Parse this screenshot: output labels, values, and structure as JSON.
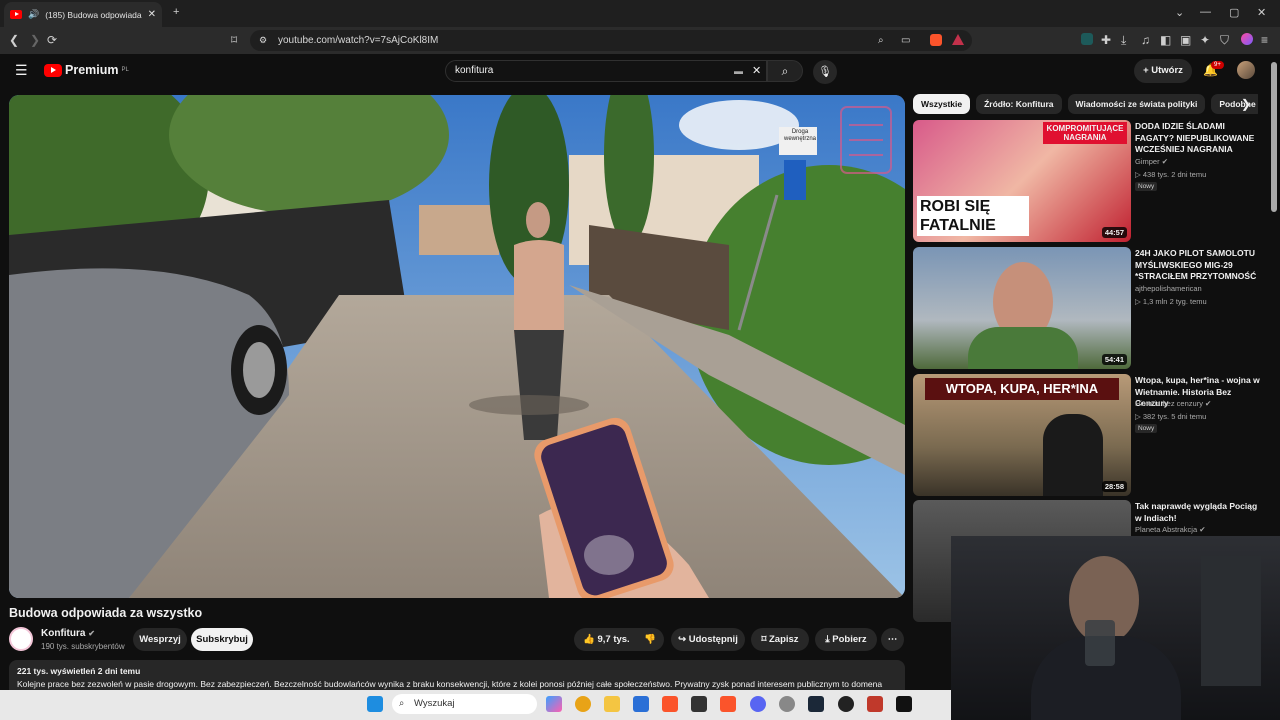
{
  "browser": {
    "tab_title": "(185) Budowa odpowiada za",
    "url": "youtube.com/watch?v=7sAjCoKl8IM"
  },
  "youtube": {
    "logo_text": "Premium",
    "logo_region": "PL",
    "search_value": "konfitura",
    "create_label": "Utwórz",
    "notifications_count": "9+"
  },
  "video": {
    "title": "Budowa odpowiada za wszystko",
    "channel": "Konfitura",
    "subscribers": "190 tys. subskrybentów",
    "support_label": "Wesprzyj",
    "subscribe_label": "Subskrybuj",
    "likes": "9,7 tys.",
    "share_label": "Udostępnij",
    "save_label": "Zapisz",
    "download_label": "Pobierz",
    "stats": "221 tys. wyświetleń  2 dni temu",
    "description": "Kolejne prace bez zezwoleń w pasie drogowym. Bez zabezpieczeń. Bezczelność budowlańców wynika z braku konsekwencji, które z kolei ponosi później całe społeczeństwo. Prywatny zysk ponad interesem publicznym to domena"
  },
  "sidebar": {
    "chips": [
      "Wszystkie",
      "Źródło: Konfitura",
      "Wiadomości ze świata polityki",
      "Podobne"
    ],
    "recommendations": [
      {
        "title": "DODA IDZIE ŚLADAMI FAGATY? NIEPUBLIKOWANE WCZEŚNIEJ NAGRANIA",
        "channel": "Gimper",
        "verified": true,
        "views": "438 tys.",
        "age": "2 dni temu",
        "badge": "Nowy",
        "duration": "44:57",
        "thumb_text": "ROBI SIĘ FATALNIE",
        "thumb_top": "KOMPROMITUJĄCE NAGRANIA"
      },
      {
        "title": "24H JAKO PILOT SAMOLOTU MYŚLIWSKIEGO MIG-29 *STRACIŁEM PRZYTOMNOŚĆ",
        "channel": "ajthepolishamerican",
        "verified": false,
        "views": "1,3 mln",
        "age": "2 tyg. temu",
        "badge": "",
        "duration": "54:41"
      },
      {
        "title": "Wtopa, kupa, her*ina - wojna w Wietnamie. Historia Bez Cenzury",
        "channel": "Historia bez cenzury",
        "verified": true,
        "views": "382 tys.",
        "age": "5 dni temu",
        "badge": "Nowy",
        "duration": "28:58",
        "thumb_text": "WTOPA, KUPA, HER*INA"
      },
      {
        "title": "Tak naprawdę wygląda Pociąg w Indiach!",
        "channel": "Planeta Abstrakcja",
        "verified": true,
        "views": "",
        "age": "",
        "badge": "",
        "duration": ""
      }
    ]
  },
  "video_overlay": {
    "sign_text": "Droga wewnętrzna"
  },
  "taskbar": {
    "search_placeholder": "Wyszukaj"
  },
  "colors": {
    "background": "#0f0f0f",
    "accent": "#ff0000",
    "chip_bg": "#272727"
  }
}
